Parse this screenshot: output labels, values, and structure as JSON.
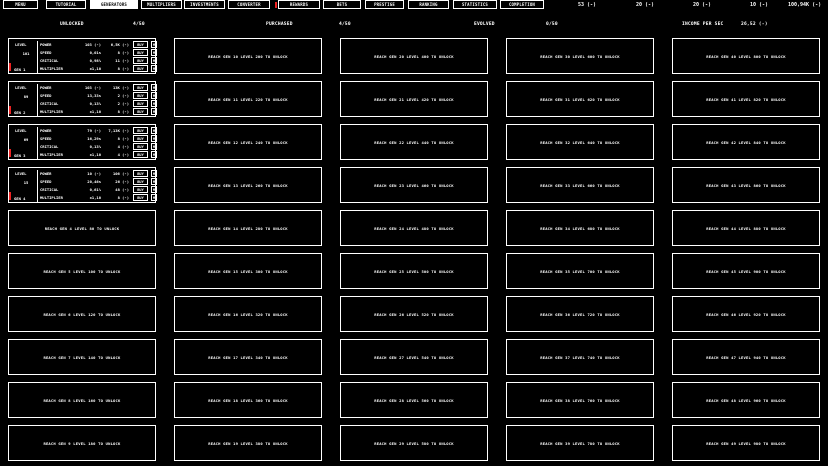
{
  "nav": {
    "tabs": [
      {
        "label": "MENU",
        "active": false
      },
      {
        "label": "TUTORIAL",
        "active": false
      },
      {
        "label": "GENERATORS",
        "active": true
      },
      {
        "label": "MULTIPLIERS",
        "active": false
      },
      {
        "label": "INVESTMENTS",
        "active": false
      },
      {
        "label": "CONVERTER",
        "active": false
      },
      {
        "label": "REWARDS",
        "active": false
      },
      {
        "label": "BETS",
        "active": false
      },
      {
        "label": "PRESTIGE",
        "active": false
      },
      {
        "label": "RANKING",
        "active": false
      },
      {
        "label": "STATISTICS",
        "active": false
      },
      {
        "label": "COMPLETION",
        "active": false
      }
    ],
    "resources": [
      "53 (-)",
      "20 (-)",
      "20 (-)",
      "10 (-)",
      "100,94K (-)"
    ]
  },
  "summary": {
    "unlocked_label": "UNLOCKED",
    "unlocked_value": "4/50",
    "purchased_label": "PURCHASED",
    "purchased_value": "4/50",
    "evolved_label": "EVOLVED",
    "evolved_value": "0/50",
    "income_label": "INCOME PER SEC",
    "income_value": "26,52 (-)"
  },
  "generators": [
    {
      "name": "GEN 1",
      "level_label": "LEVEL",
      "level": "101",
      "buy": "BUY",
      "max": "M",
      "stats": [
        {
          "label": "POWER",
          "value": "103 (-)",
          "cost": "6,5K (-)"
        },
        {
          "label": "SPEED",
          "value": "0,01s",
          "cost": "8 (-)"
        },
        {
          "label": "CRITICAL",
          "value": "0,98%",
          "cost": "11 (-)"
        },
        {
          "label": "MULTIPLIER",
          "value": "x1,10",
          "cost": "8 (-)"
        }
      ]
    },
    {
      "name": "GEN 2",
      "level_label": "LEVEL",
      "level": "89",
      "buy": "BUY",
      "max": "M",
      "stats": [
        {
          "label": "POWER",
          "value": "103 (-)",
          "cost": "13K (-)"
        },
        {
          "label": "SPEED",
          "value": "13,33s",
          "cost": "2 (-)"
        },
        {
          "label": "CRITICAL",
          "value": "0,13%",
          "cost": "2 (-)"
        },
        {
          "label": "MULTIPLIER",
          "value": "x1,10",
          "cost": "8 (-)"
        }
      ]
    },
    {
      "name": "GEN 3",
      "level_label": "LEVEL",
      "level": "69",
      "buy": "BUY",
      "max": "M",
      "stats": [
        {
          "label": "POWER",
          "value": "79 (-)",
          "cost": "7,13K (-)"
        },
        {
          "label": "SPEED",
          "value": "16,29s",
          "cost": "8 (-)"
        },
        {
          "label": "CRITICAL",
          "value": "0,13%",
          "cost": "4 (-)"
        },
        {
          "label": "MULTIPLIER",
          "value": "x1,10",
          "cost": "4 (-)"
        }
      ]
    },
    {
      "name": "GEN 4",
      "level_label": "LEVEL",
      "level": "15",
      "buy": "BUY",
      "max": "M",
      "stats": [
        {
          "label": "POWER",
          "value": "10 (-)",
          "cost": "106 (-)"
        },
        {
          "label": "SPEED",
          "value": "20,46s",
          "cost": "26 (-)"
        },
        {
          "label": "CRITICAL",
          "value": "0,61%",
          "cost": "48 (-)"
        },
        {
          "label": "MULTIPLIER",
          "value": "x1,10",
          "cost": "8 (-)"
        }
      ]
    }
  ],
  "locked": {
    "col1": [
      "REACH GEN 4 LEVEL 80 TO UNLOCK",
      "REACH GEN 5 LEVEL 100 TO UNLOCK",
      "REACH GEN 6 LEVEL 120 TO UNLOCK",
      "REACH GEN 7 LEVEL 140 TO UNLOCK",
      "REACH GEN 8 LEVEL 160 TO UNLOCK",
      "REACH GEN 9 LEVEL 180 TO UNLOCK"
    ],
    "col2": [
      "REACH GEN 10 LEVEL 200 TO UNLOCK",
      "REACH GEN 11 LEVEL 220 TO UNLOCK",
      "REACH GEN 12 LEVEL 240 TO UNLOCK",
      "REACH GEN 13 LEVEL 260 TO UNLOCK",
      "REACH GEN 14 LEVEL 280 TO UNLOCK",
      "REACH GEN 15 LEVEL 300 TO UNLOCK",
      "REACH GEN 16 LEVEL 320 TO UNLOCK",
      "REACH GEN 17 LEVEL 340 TO UNLOCK",
      "REACH GEN 18 LEVEL 360 TO UNLOCK",
      "REACH GEN 19 LEVEL 380 TO UNLOCK"
    ],
    "col3": [
      "REACH GEN 20 LEVEL 400 TO UNLOCK",
      "REACH GEN 21 LEVEL 420 TO UNLOCK",
      "REACH GEN 22 LEVEL 440 TO UNLOCK",
      "REACH GEN 23 LEVEL 460 TO UNLOCK",
      "REACH GEN 24 LEVEL 480 TO UNLOCK",
      "REACH GEN 25 LEVEL 500 TO UNLOCK",
      "REACH GEN 26 LEVEL 520 TO UNLOCK",
      "REACH GEN 27 LEVEL 540 TO UNLOCK",
      "REACH GEN 28 LEVEL 560 TO UNLOCK",
      "REACH GEN 29 LEVEL 580 TO UNLOCK"
    ],
    "col4": [
      "REACH GEN 30 LEVEL 600 TO UNLOCK",
      "REACH GEN 31 LEVEL 620 TO UNLOCK",
      "REACH GEN 32 LEVEL 640 TO UNLOCK",
      "REACH GEN 33 LEVEL 660 TO UNLOCK",
      "REACH GEN 34 LEVEL 680 TO UNLOCK",
      "REACH GEN 35 LEVEL 700 TO UNLOCK",
      "REACH GEN 36 LEVEL 720 TO UNLOCK",
      "REACH GEN 37 LEVEL 740 TO UNLOCK",
      "REACH GEN 38 LEVEL 760 TO UNLOCK",
      "REACH GEN 39 LEVEL 780 TO UNLOCK"
    ],
    "col5": [
      "REACH GEN 40 LEVEL 800 TO UNLOCK",
      "REACH GEN 41 LEVEL 820 TO UNLOCK",
      "REACH GEN 42 LEVEL 840 TO UNLOCK",
      "REACH GEN 43 LEVEL 860 TO UNLOCK",
      "REACH GEN 44 LEVEL 880 TO UNLOCK",
      "REACH GEN 45 LEVEL 900 TO UNLOCK",
      "REACH GEN 46 LEVEL 920 TO UNLOCK",
      "REACH GEN 47 LEVEL 940 TO UNLOCK",
      "REACH GEN 48 LEVEL 960 TO UNLOCK",
      "REACH GEN 49 LEVEL 980 TO UNLOCK"
    ]
  },
  "colors": {
    "accent": "#ffffff",
    "background": "#000000",
    "marker": "#e22222"
  }
}
